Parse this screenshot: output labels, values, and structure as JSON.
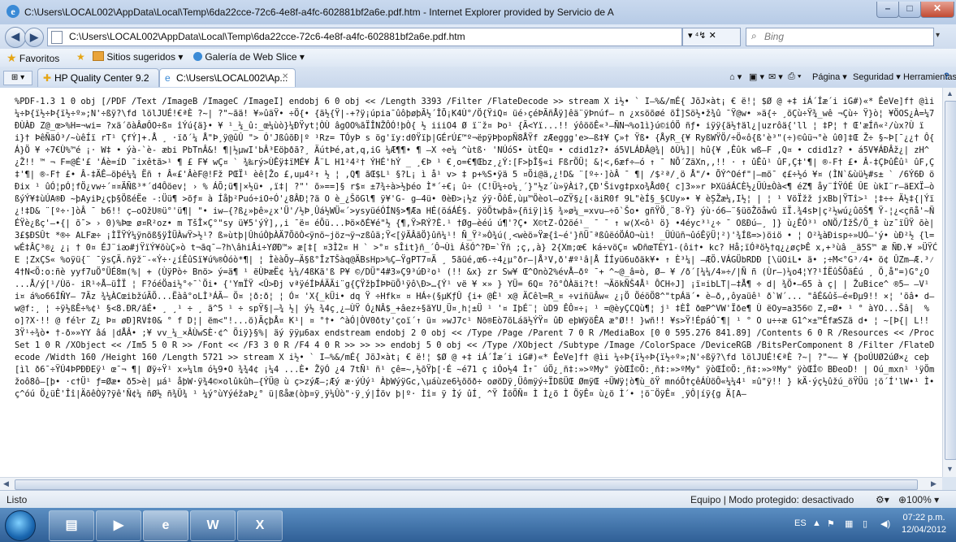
{
  "window": {
    "title": "C:\\Users\\LOCAL002\\AppData\\Local\\Temp\\6da22cce-72c6-4e8f-a4fc-602881bf2a6e.pdf.htm - Internet Explorer provided by Servicio de A",
    "min": "–",
    "max": "□",
    "close": "✕"
  },
  "nav": {
    "back": "◀",
    "forward": "▶",
    "address": "C:\\Users\\LOCAL002\\AppData\\Local\\Temp\\6da22cce-72c6-4e8f-a4fc-602881bf2a6e.pdf.htm",
    "addr_tools": "▾  ⁴↯  ✕",
    "search_placeholder": "Bing"
  },
  "favorites": {
    "label": "Favoritos",
    "items": [
      "Sitios sugeridos ▾",
      "Galería de Web Slice ▾"
    ]
  },
  "tabs": [
    {
      "label": "HP Quality Center 9.2"
    },
    {
      "label": "C:\\Users\\LOCAL002\\Ap...",
      "close": "✕"
    }
  ],
  "commandbar": [
    "Página ▾",
    "Seguridad ▾",
    "Herramientas ▾",
    "?"
  ],
  "content": {
    "text": "%PDF-1.3 1 0 obj [/PDF /Text /ImageB /ImageC /ImageI] endobj 6 0 obj << /Length 3393 /Filter /FlateDecode >> stream X i½• ` I–%&/mÉ{ JõJ×àt¡ € ë!¦ $Ø @ +‡ iÁ´Íæ´i iG#)«* ÊeVe]f† @ìi ¼÷Þ{ï½÷Þ{ï½÷º»;N'÷ßÿ?\\fd lölJUÉ!€ªÈ ?~| ?\"~ãä! ¥»ûäŸ• ÷Ö{• {ä½{Ÿ|-+?ÿ¡úpia¯ûôþøþÃ½´ÎÕ¡K4Ù°/Ö{ŸiQ¤ üé›çéÞÃñÅÿ]êä¨ÿÞnúf– n ¿xsöõøé õÍ]Sö½•ž¾û ¯Ÿ@w• »ä{÷ ¸õÇù÷Ÿ¾_wê ¬Çù÷ Ÿ}ò¦ ¥ÖOS¿À=¼7ÐÙÀÐ Z@_œ>%H=¬wi= ?xä´õàÂøÔO÷ß¤ îÝú{ä}• ¥ ¹_¼_û:_œ¼ùò}¼ÐŸyt¦ÒÙ âgOO%ãÏÎNŽÔÓ!þÒ{ ½ iiiO4 Ø ï¨ž¤ Þo¹ {Ã<Yï...!! ýôöõÊ«³—ÑN¬%o1ì}ú©iÓÖ ñƒ• iÿÿ{ä½†äl¿|uzrôä{'ll ¦ ‡P¦ † Œ'æÍñ«²/ùx?Ù ï i}† ÞêÑäÓ³/~ùêÍï rT¹ ÇfÝ]+.Å ¸ ·ïð´¼ Å\"Þ¸ÿ@ûÛ \"> Ó'JßûõÐ|º ¹Rz= TÓyÞ s ög'ïy:d0Ÿïþ|GÉrÚ£™º¬ëpÿÞþopÑ8ÅŸf zÆeggg'e>–ß‡¥ Ç»† Ÿß• {ÅyR_{¥ RyßWŸÖ/÷Ö«ô{ß'è³\"(÷)©ûü¬°è û0]‡Œ Ž÷ §~Þ[¯¿¿† Ô{ Á}Ö ¥ ÷7€Ù%™é ¡· W‡ • ýà-`è- æbi PbTnÂ&! ¶|½µwI'bÂ³Eöþðã?¸ ÄútÞé,at,q,iG ¼Æ¶¶• ¶ —X ÷e¼ ^ùtß· 'NÚóS• ùtÉQ¤ • cdid1z?• á5VLÁÐÂ@¾| ðÙ¼]| hû{¥ ,Êûk wß—F ,Q¤ • cdid1z? • á5V¥ÁÐÂž¿| zH^¿Ž!! ™ ¬ F=@É'£ 'Áè=íD ¯ixêtã>¹ ¶ £ F¥ wÇ¤ ` ¾‰rý>ÙÊÿ‡ïMÉ¥ Å¨L H1²4²† ÝHÉ'hÝ _ ¸€Þ ¹ €¸o=€¶Œbz¸¿Ý:[F>þÎ§«i FßrÖÜ¦ &¦<,6æf÷—ó ↑ ¯ NÕ´ZäXn,,!! · ↑ ûÊû¹ ûF,Ç‡'¶| ®-F† £• Â-‡ÇÞûÊû¹ ûF,Ç‡'¶| ®-F† £• Â-‡ÄÊ–öþé¼¾ Ëñ ↑ Â«£'ÂèF@!Fž PŒÏ¹ èê[Žo £,uµ4²↑ ½ ¦ ,Q¶ ãŒ$L¹ §?L¡ ì å¹ v> ‡ p+%S•ÿä 5 ¤Öi@ä,¿!D& ¨[º÷·]òÂ ¯ ¶| /$²ª/¸ö Å\"/• ÕÝ^Oéf\"|—mõ¯ ¢£÷½ó ¥¤ (ÌN`&ùü½#s± ` /6Ý6Ð öÐix ¹ ûÓ¦pÓ¦fÖ¿vw÷´¤¤ÄÑß³*´d4Ôöev¦ › % ÁÕ;ü¶|×½ü• ,ï‡| ?\"' õ»==]§ r$¤ ±7¾÷à>½þéo Ì*´÷€¡ û÷ (C!Ü¼÷o¼¸´}\"½z´ù»ÿÀi?,ÇÐ'Šivg‡pxo¾Åd0{ c]3»»r ÞXüáÁCÈ½¿ÜÚ±Òà<¶ éZ¶ åy¨ÍŸÓÉ ÛE ùkI¨r–äEXÏ–òßýÝ¥‡ùÚA®Ð ~þAyiÞ¿çþ§ÖßéËe -:Üü¶ >õƒ¤ à Íåþ²Puó÷iO÷Ó'¿8ÂÐ¦?ä O è_¿ŠõGl¶ ÿ¥'G- g—4ü• 0èÐ>¡½z ýÿ·ÕôÉ,ùµ™Öèol—oZŸ§¿[‹äiR0f 9L\"èÍ§_§CUy»• ¥ èȘŽæ¼,I½¦ | ¦ ¹ VöÏžž jxBb|ŸTî>¹ ¦‡÷÷ Ä½‡{|Ýï ¿!‡D& ¨[º÷·]òÂ ¯ b6!! ç—oOžU®ü°'ü¶| \"• iw—{?ß¿»þê»¿x'Ü'/½Þ¸Ûá½WÜ«´>ysyüéÓÍN§>¶Æa HÉ(öáÁÉ§. ÿöÕtwþâ»{ñiÿ|ì§ ¾»ø¼_=xvu–÷õ`Šo• gñŸÖ¸¨8-Ÿ} ýù·ó6—¨§üõŽöåwû ïÏ.¾4sÞ|ç²½wú¿ûõŠ¶ Ÿ-¦¿<çñå'~ÑÉŸè¿ßç'–•{| õ¯> › 0)%Þœ ø¤R²oz• m TšÎ×Ç°\"sy ü¥5'ýÝ],,i ¯ë¤ éÕü...Þö×ðÉ¥é\"½ {¶,Ÿ>RÝ?È.¹ †Øg—èéú ú¶'?Ç• X©tZ-Ó2öé¹_ ¯ ¯ ↑ w(X<ô¹ ö} •4éyc³¹¿÷ ¯ OßÐú—¸ ]} ù¿ÊÓ³¹ oNÖ/ÌžŠ/Ö_‡ ùz¯ïÜŸ õè| 3£$ÐSÛt *®÷ ALFæ÷ ¡ÌÏŸÝ¼ÿnõß§ÿÌÜÀwŸ>½¹? ß»ùtþ|ÛhúÒþÀÄ7ÕõÒ<ÿnö~jöz¬ÿ¬zßûä;Ÿ<[ÿÄÂãÖ}ûñ¼¹! Ñ_Ÿ²»Ò¾ú(¸<wèö»Ÿæ{î~é'}ñÜ¯ªßûëóÖÁO¬ùì! _ÜÚüñ¬ûóÊÿÜ¦²)'¾Íß=>)öiö • ¦ O²¼àÐisp÷»UÓ—'ý• ùÐ²½ {l=wÉ‡ÂÇ³®¿ ¿¡ † 0¤ ÉJ¨iꜵ#jŸïÝ¥õùÇ»ò t¬ãq¯—?h\\âhiÂi÷YØÐ™» æ[‡[ ¤3Ì2¤ H ` >°¤ sÎit}ñ_´Ô¬Ùì ÁšÓ^?Ð=`Ÿñ ;ç,,à} 2{Xm;œ€ ká÷vöÇ¤ wDñœTÉY1-(ôi†• kc? Hå;ïÓªö½†q¿¿øçÞÊ x,+³ùâ _ä5S™ æ ÑĐ.¥ »ÜŸĆE ¦ZxÇS« %oÿü{¨ ¯ÿsÇÄ.ñÿž¨-«Ý÷·¿íÊûSï¥ú%®Òóò*¶| ¦ ÌèàÕy—Ä§ß°ÎzTŠàq@ÄBsHp>%Ç–ŸgPT7¤Ä ¸ 5ãüé,œ6-÷4¿µ°ðr–|Å³V,ð'#º¹â|Å ÍÍyü6uðäk¥• ↑ È³¼| —ÆÖ.VÁGÜbRDÐ [\\üOiL• ä• ;÷M<°G³⁄4• ö¢ ÛZm–Æ.³⁄4†N<Ö:o:ñè yyf7uÖ°ÜÉ8m(%| + (ÙÿPò÷ Bnö> ý=ä¶ ¹ ëÙÞæË¢ ¼¼/4ßKä'ß P¥ ©/DÜ\"4#3»Ç9³úÐ²o¹ (!! &x} zr Sw¥ Œ^Onò2%évÅ—ðº ¯+ ^~@_â=ò, Ø— ¥ /ð´[¼¼/4»÷/|Ñ ñ (Ùr—)¼o4¦Y?¹ÍËûŠÕäÉú ¸ Ö¸å\"=)G°¿O ...Å/ý[¹/Ùö- iR¹÷Å–üÎÏ ¦ F?óéÖai½°÷¯`Öi• {'YmÏŸ <Û>Ðj vªÿéÍÞÁÄÄi¨g{ÇŸžþÍÞÞüÕ¹ÿô\\Ð>…{Ý¹ vë ¥ ×» } YÜ= 6Q¤ ?õ°ÒÀäi?t! ¬ÄökÑŠ4Å¹ ÔCH÷J] ¡ï¤ibLT|–‡Å¶ ÷ d| ¾Ö•—65 à ç| | ŽuBice^ ®5– —V¹ i¤ á%o66ÍÑY– 7Ãz ¾¼ÀCœibžúÃÕ...Ëàâ°oLÌ³ÁÃ– Ö¤ ¦ð:ð¦ ¦ Ó¤ 'X{_kÜi• dq Ÿ ÷Hfk¤ ¤ HÁ÷(§µKƒÛ {i+ @È¹ x@ ÄCêŀ=R_¤ ÷viñüÂw« ¿¡Ö ÖéöÖ8^\"tpÁä´• è–ð,,ôyaüê¹ ð`W´... \"âÉ&ûš–é«Ðµ9!! ×¦ 'õâ• d—w@f:¸ ¦ ÷ÿ½ßÊ÷%¢¹ §<8.ÐR/ãÉ• ¸ ¸¹ ÷ ¸ ã^5 ¹ ÷ spŸ§|—¾ ½| ý½ ¾4ç¸¿–ÙŸ Ó¿NÂ$_+âez÷§ãYU¸Ü¤¸h¦±Ü ¹ '¤ IþÉ¨¦ ùD9 ÊÔ¤÷¡ ¹ =@èyÇCQù¶¦ j¹ ‡ÈÎ ðœP^VW'Ïðe¶ Ù ëOy=a356© Z,=Ø• ¹ ° àYO...Šâ|  %o]?X·!! @ féŀr Z¿ Þ¤ øÐ]RV‡0& ° f D¦| ëm<\"!...ö)ÃçþÅ¤ K¹| ¤ °†• ^àÓ|ÒV0ðty'çoḯ ↑ ü¤ »wJ7c¹ Nõ®Eò7õLáä½ÝŸ¤ ûÐ eþWÿöÊA æ°Ø!! }wñ!! ¥s>Ÿ!ÉpáÓ¯¶| ¹ ° O u÷÷æ G1^×±™ÉfæSZä d• ¦ ~[Þ{| L!! 3Ÿ¹÷¾ò• †-ð»»YY âá |dÅÂ• ;¥ vv_¼_×ÂÙwSÈ·¢^ Öiÿ}§%| äý ÿÿµ6ax endstream endobj 2 0 obj << /Type /Page /Parent 7 0 R /MediaBox [0 0 595.276 841.89] /Contents 6 0 R /Resources << /ProcSet 1 0 R /XObject << /Im5 5 0 R >> /Font << /F3 3 0 R /F4 4 0 R >> >> >> endobj 5 0 obj << /Type /XObject /Subtype /Image /ColorSpace /DeviceRGB /BitsPerComponent 8 /Filter /FlateDecode /Width 160 /Height 160 /Length 5721 >> stream X i½• ` I–%&/mÉ{ JõJ×àt¡ € ë!¦ $Ø @ +‡ iÁ´Íæ´i iG#)«* ÊeVe]f† @ìi ¼÷Þ{ï½÷Þ{ï½÷º»;N'÷ßÿ?\\fd lölJUÉ!€ªÈ ?~| ?\"~— ¥ {þoÚUØ2úØ×¿ ceþ[ìl ð6¯÷ŸÚ4ÞPÐÐEÿ¹ œ¯¬ ¶| Øÿ÷Ÿ¹ x»¼lm ó¼9•O ¾¾4¢ ¡¼4 ...È• ŽÿÓ ¿4 7tÑ¹ ñ¹ çê=~,½õŸþ[·É ~é71 ç iÓo½4 Ì↑¯ úÖ¿¸ñ‡:»>ºMy° ÿòŒÍ©Ö:¸ñ‡:»>ºMy° ÿòŒÍ©Ö:¸ñ‡:»>ºMy° ÿòŒÍ© BÐeoD! | Oú_mxn¹ ¹ÿÖmžoô8ô—[þ• ·c†Ü¹ ƒ=Øæ• ð5>è| µá¹ åþW·ÿ¾4©×olûkûh–{ÝÜ@ ù ç>zýÆ–;Æý æ·ýÚý¹ ÀþWýÿGc,\\µáùze6¼õõð÷ oøöDÿ¸Üômÿý÷ÏDßÜŒ ØmÿŒ ÷ÜWÿ¦ò¶ù_õŸ mnóÔ†çêÁÙöÔ«¼¼4¹ ¤û\"ÿ!! } kÄ·ýç½ûžú_öŸÜü ¦ö´Í'lW•¹ Ì•ç^óú Ö¿üÊ'Îî|ÄõêÒÿ?ÿê'Ñ¢¼ ñØ½ ñ¾Ü¾ ¹ ¼ý°ùYýéžaÞ¿° ü|ßåæ(òþ¤ÿ¸ÿ¼Ûò\"·ÿ¸ý|Íöv þ|º· Ìî¤ ÿ Ìý ûÍ¸ ^Ÿ ÎöÕÑ¤ Ì Ì¿ö Ì ÖÿÊ¤ ù¿ö Ì´• ¦ö¨ÖÿÊ¤ ¸ÿÔ|íÿ{g Ä[A—"
  },
  "statusbar": {
    "left": "Listo",
    "zone": "Equipo | Modo protegido: desactivado",
    "zoom": "⊕100%  ▾"
  },
  "taskbar": {
    "apps": [
      "Explorer",
      "Media",
      "Internet Explorer",
      "Word",
      "Excel"
    ],
    "lang": "ES",
    "time": "07:22 p.m.",
    "date": "12/04/2012"
  }
}
